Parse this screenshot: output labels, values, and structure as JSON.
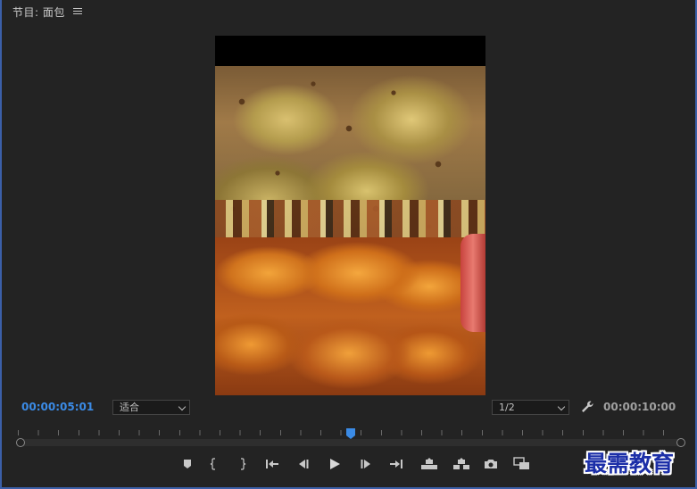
{
  "panel": {
    "title": "节目: 面包"
  },
  "playback": {
    "current_time": "00:00:05:01",
    "total_time": "00:00:10:00",
    "playhead_fraction": 0.5
  },
  "zoom": {
    "selected": "适合"
  },
  "resolution": {
    "selected": "1/2"
  },
  "transport": {
    "buttons": [
      "add-marker",
      "mark-in",
      "mark-out",
      "go-to-in",
      "step-back",
      "play",
      "step-forward",
      "go-to-out",
      "lift",
      "extract",
      "export-frame",
      "compare-view"
    ]
  },
  "watermark": {
    "text": "最需教育"
  },
  "colors": {
    "accent": "#3b8be6",
    "panel_border": "#3b5fa8",
    "background": "#232323"
  }
}
